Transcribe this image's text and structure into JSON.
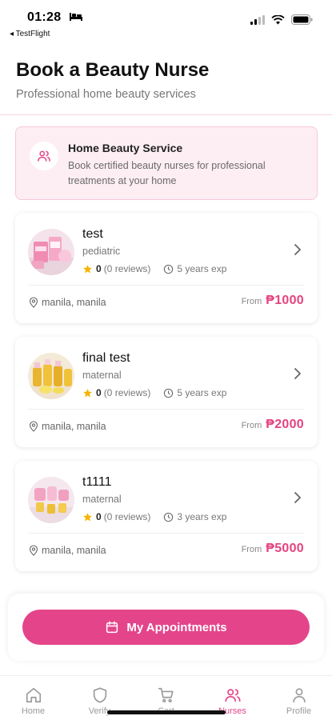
{
  "status_bar": {
    "time": "01:28",
    "back_app": "◂ TestFlight"
  },
  "header": {
    "title": "Book a Beauty Nurse",
    "subtitle": "Professional home beauty services"
  },
  "info": {
    "title": "Home Beauty Service",
    "description": "Book certified beauty nurses for professional treatments at your home",
    "icon": "users-icon"
  },
  "nurses": [
    {
      "name": "test",
      "specialty": "pediatric",
      "rating": "0",
      "reviews": "(0 reviews)",
      "experience": "5 years exp",
      "location": "manila, manila",
      "from_label": "From",
      "price": "₱1000"
    },
    {
      "name": "final test",
      "specialty": "maternal",
      "rating": "0",
      "reviews": "(0 reviews)",
      "experience": "5 years exp",
      "location": "manila, manila",
      "from_label": "From",
      "price": "₱2000"
    },
    {
      "name": "t1111",
      "specialty": "maternal",
      "rating": "0",
      "reviews": "(0 reviews)",
      "experience": "3 years exp",
      "location": "manila, manila",
      "from_label": "From",
      "price": "₱5000"
    }
  ],
  "appointments": {
    "label": "My Appointments",
    "icon": "calendar-icon"
  },
  "nav": {
    "items": [
      {
        "label": "Home",
        "icon": "home-icon"
      },
      {
        "label": "Verify",
        "icon": "shield-icon"
      },
      {
        "label": "Cart",
        "icon": "cart-icon"
      },
      {
        "label": "Nurses",
        "icon": "users-icon",
        "active": true
      },
      {
        "label": "Profile",
        "icon": "user-icon"
      }
    ]
  },
  "colors": {
    "accent": "#e4448a",
    "price": "#e4437f",
    "info_bg": "#fdeef4",
    "star": "#f5b400"
  }
}
